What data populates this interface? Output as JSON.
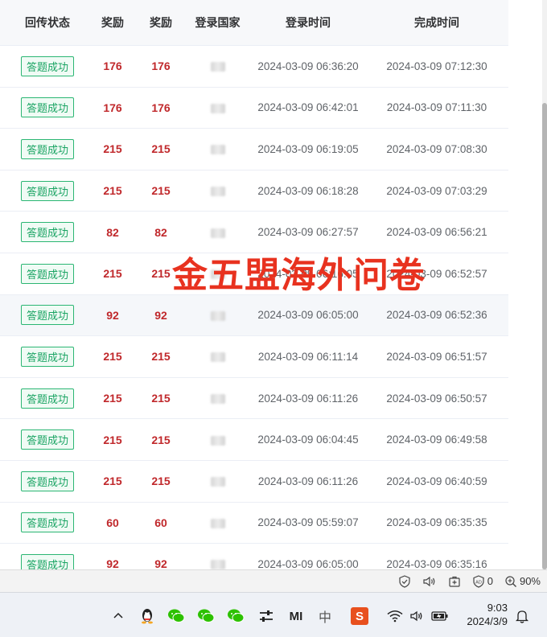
{
  "table": {
    "headers": [
      "回传状态",
      "奖励",
      "奖励",
      "登录国家",
      "登录时间",
      "完成时间"
    ],
    "rows": [
      {
        "status": "答题成功",
        "reward1": "176",
        "reward2": "176",
        "login": "2024-03-09 06:36:20",
        "done": "2024-03-09 07:12:30"
      },
      {
        "status": "答题成功",
        "reward1": "176",
        "reward2": "176",
        "login": "2024-03-09 06:42:01",
        "done": "2024-03-09 07:11:30"
      },
      {
        "status": "答题成功",
        "reward1": "215",
        "reward2": "215",
        "login": "2024-03-09 06:19:05",
        "done": "2024-03-09 07:08:30"
      },
      {
        "status": "答题成功",
        "reward1": "215",
        "reward2": "215",
        "login": "2024-03-09 06:18:28",
        "done": "2024-03-09 07:03:29"
      },
      {
        "status": "答题成功",
        "reward1": "82",
        "reward2": "82",
        "login": "2024-03-09 06:27:57",
        "done": "2024-03-09 06:56:21"
      },
      {
        "status": "答题成功",
        "reward1": "215",
        "reward2": "215",
        "login": "2024-03-09 06:16:05",
        "done": "2024-03-09 06:52:57"
      },
      {
        "status": "答题成功",
        "reward1": "92",
        "reward2": "92",
        "login": "2024-03-09 06:05:00",
        "done": "2024-03-09 06:52:36"
      },
      {
        "status": "答题成功",
        "reward1": "215",
        "reward2": "215",
        "login": "2024-03-09 06:11:14",
        "done": "2024-03-09 06:51:57"
      },
      {
        "status": "答题成功",
        "reward1": "215",
        "reward2": "215",
        "login": "2024-03-09 06:11:26",
        "done": "2024-03-09 06:50:57"
      },
      {
        "status": "答题成功",
        "reward1": "215",
        "reward2": "215",
        "login": "2024-03-09 06:04:45",
        "done": "2024-03-09 06:49:58"
      },
      {
        "status": "答题成功",
        "reward1": "215",
        "reward2": "215",
        "login": "2024-03-09 06:11:26",
        "done": "2024-03-09 06:40:59"
      },
      {
        "status": "答题成功",
        "reward1": "60",
        "reward2": "60",
        "login": "2024-03-09 05:59:07",
        "done": "2024-03-09 06:35:35"
      },
      {
        "status": "答题成功",
        "reward1": "92",
        "reward2": "92",
        "login": "2024-03-09 06:05:00",
        "done": "2024-03-09 06:35:16"
      }
    ]
  },
  "overlay": {
    "title": "金五盟海外问卷"
  },
  "statusbar": {
    "ad_count": "0",
    "zoom": "90%"
  },
  "taskbar": {
    "time": "9:03",
    "date": "2024/3/9",
    "ime_label": "中",
    "sogou_label": "S",
    "mi_label": "MI"
  },
  "colors": {
    "success_green": "#1aa463",
    "reward_red": "#c0282b",
    "overlay_red": "#e8321f"
  }
}
